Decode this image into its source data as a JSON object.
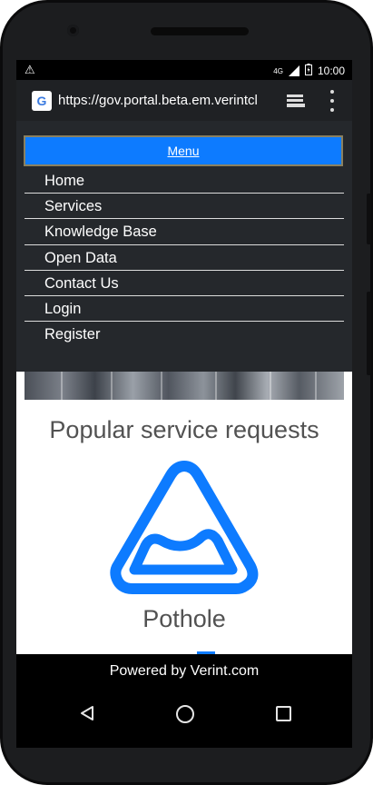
{
  "status_bar": {
    "network": "4G",
    "time": "10:00",
    "warning_icon": "warning-icon"
  },
  "browser": {
    "url": "https://gov.portal.beta.em.verintcl"
  },
  "menu": {
    "toggle_label": "Menu",
    "items": [
      {
        "label": "Home"
      },
      {
        "label": "Services"
      },
      {
        "label": "Knowledge Base"
      },
      {
        "label": "Open Data"
      },
      {
        "label": "Contact Us"
      },
      {
        "label": "Login"
      },
      {
        "label": "Register"
      }
    ]
  },
  "content": {
    "section_title": "Popular service requests",
    "service_label": "Pothole",
    "accent_color": "#0d7bff"
  },
  "footer": {
    "text": "Powered by Verint.com"
  }
}
